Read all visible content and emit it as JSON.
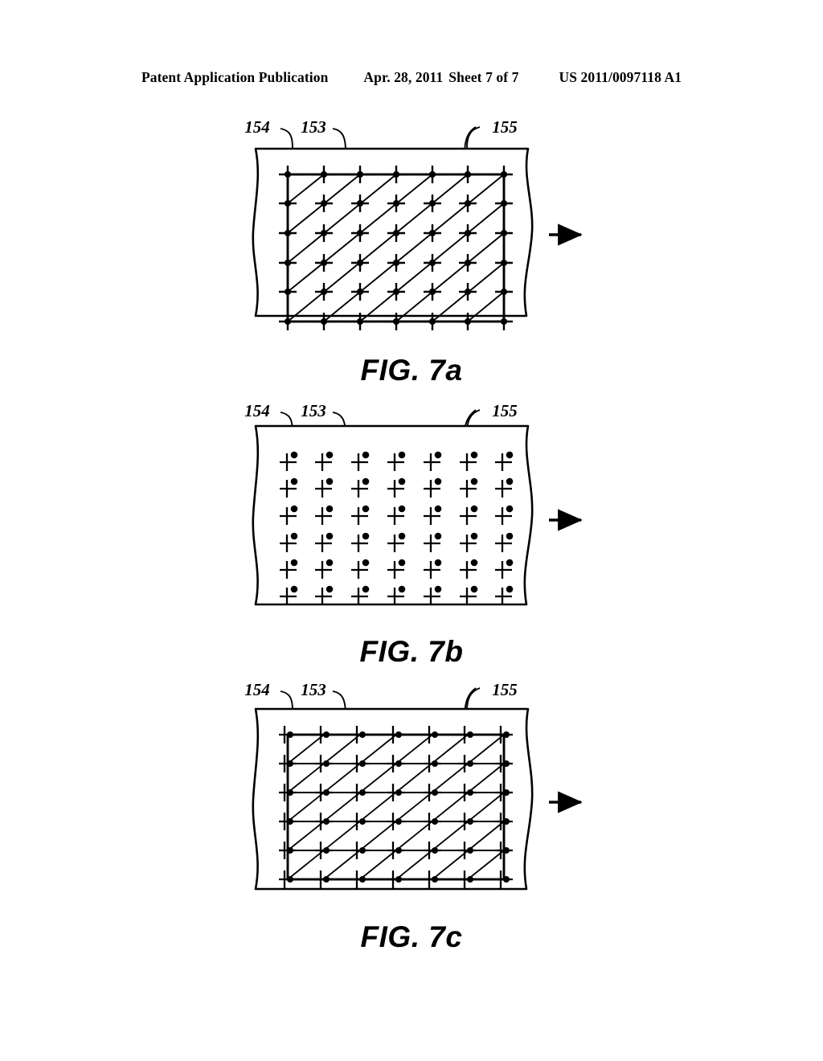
{
  "header": {
    "publication": "Patent Application Publication",
    "date": "Apr. 28, 2011",
    "sheet": "Sheet 7 of 7",
    "patent_number": "US 2011/0097118 A1"
  },
  "figures": [
    {
      "id": "7a",
      "caption": "FIG. 7a",
      "reference_numerals": [
        "154",
        "153",
        "155"
      ],
      "grid": {
        "columns": 7,
        "rows": 6
      },
      "features": {
        "border_rectangle": true,
        "diagonal_lines": true,
        "interior_grid_lines": false,
        "marker": "cross-with-centered-dot",
        "flow_arrow": true,
        "broken_edges": "wavy-left-and-right"
      }
    },
    {
      "id": "7b",
      "caption": "FIG. 7b",
      "reference_numerals": [
        "154",
        "153",
        "155"
      ],
      "grid": {
        "columns": 7,
        "rows": 6
      },
      "features": {
        "border_rectangle": false,
        "diagonal_lines": false,
        "interior_grid_lines": false,
        "marker": "cross-with-upper-right-dot",
        "flow_arrow": true,
        "broken_edges": "wavy-left-and-right"
      }
    },
    {
      "id": "7c",
      "caption": "FIG. 7c",
      "reference_numerals": [
        "154",
        "153",
        "155"
      ],
      "grid": {
        "columns": 7,
        "rows": 6
      },
      "features": {
        "border_rectangle": true,
        "diagonal_lines": true,
        "interior_grid_lines": true,
        "marker": "cross-with-offset-right-dot",
        "flow_arrow": true,
        "broken_edges": "wavy-left-and-right"
      }
    }
  ],
  "colors": {
    "ink": "#000000",
    "paper": "#ffffff"
  }
}
